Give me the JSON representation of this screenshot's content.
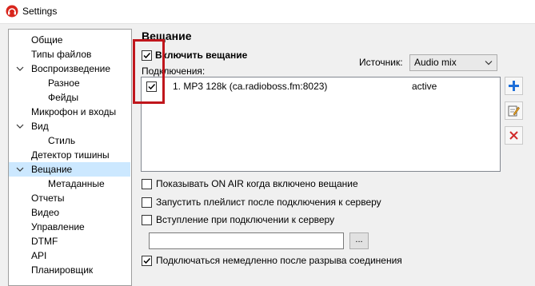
{
  "window": {
    "title": "Settings"
  },
  "tree": {
    "items": [
      {
        "label": "Общие"
      },
      {
        "label": "Типы файлов"
      },
      {
        "label": "Воспроизведение",
        "expanded": true
      },
      {
        "label": "Разное"
      },
      {
        "label": "Фейды"
      },
      {
        "label": "Микрофон и входы"
      },
      {
        "label": "Вид",
        "expanded": true
      },
      {
        "label": "Стиль"
      },
      {
        "label": "Детектор тишины"
      },
      {
        "label": "Вещание",
        "expanded": true,
        "selected": true
      },
      {
        "label": "Метаданные"
      },
      {
        "label": "Отчеты"
      },
      {
        "label": "Видео"
      },
      {
        "label": "Управление"
      },
      {
        "label": "DTMF"
      },
      {
        "label": "API"
      },
      {
        "label": "Планировщик"
      }
    ]
  },
  "main": {
    "section_title": "Вещание",
    "enable_broadcast": {
      "label": "Включить вещание",
      "checked": true
    },
    "source": {
      "label": "Источник:",
      "value": "Audio mix"
    },
    "connections": {
      "label": "Подключения:",
      "rows": [
        {
          "checked": true,
          "name": "1. MP3 128k (ca.radioboss.fm:8023)",
          "status": "active"
        }
      ]
    },
    "buttons": {
      "add_icon": "plus-icon",
      "edit_icon": "edit-icon",
      "remove_icon": "delete-icon"
    },
    "options": {
      "show_on_air": {
        "label": "Показывать ON AIR когда включено вещание",
        "checked": false
      },
      "start_playlist": {
        "label": "Запустить плейлист после подключения к серверу",
        "checked": false
      },
      "intro_on_connect": {
        "label": "Вступление при подключении к серверу",
        "checked": false
      },
      "intro_path": {
        "value": ""
      },
      "browse_label": "...",
      "reconnect": {
        "label": "Подключаться немедленно после разрыва соединения",
        "checked": true
      }
    }
  },
  "colors": {
    "highlight": "#c0161c",
    "selection": "#cce8ff",
    "accent": "#1e6fd9"
  }
}
